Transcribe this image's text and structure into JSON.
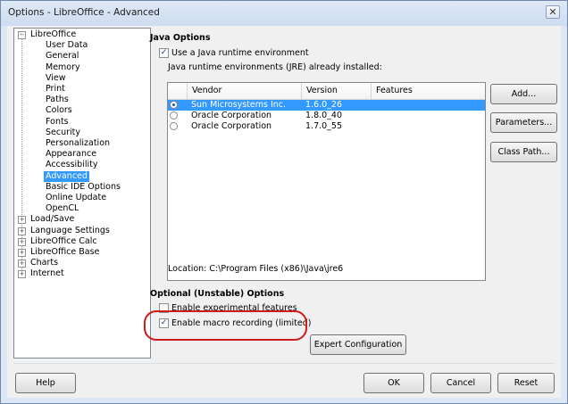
{
  "window": {
    "title": "Options - LibreOffice - Advanced",
    "close_glyph": "✕"
  },
  "tree": {
    "root_label": "LibreOffice",
    "root_children": [
      "User Data",
      "General",
      "Memory",
      "View",
      "Print",
      "Paths",
      "Colors",
      "Fonts",
      "Security",
      "Personalization",
      "Appearance",
      "Accessibility",
      "Advanced",
      "Basic IDE Options",
      "Online Update",
      "OpenCL"
    ],
    "selected": "Advanced",
    "collapsed": [
      "Load/Save",
      "Language Settings",
      "LibreOffice Calc",
      "LibreOffice Base",
      "Charts",
      "Internet"
    ],
    "expanded_glyph": "−",
    "collapsed_glyph": "+"
  },
  "java": {
    "section_title": "Java Options",
    "use_jre_label": "Use a Java runtime environment",
    "use_jre_checked": true,
    "installed_label": "Java runtime environments (JRE) already installed:",
    "columns": {
      "vendor": "Vendor",
      "version": "Version",
      "features": "Features"
    },
    "rows": [
      {
        "vendor": "Sun Microsystems Inc.",
        "version": "1.6.0_26",
        "features": "",
        "selected": true
      },
      {
        "vendor": "Oracle Corporation",
        "version": "1.8.0_40",
        "features": "",
        "selected": false
      },
      {
        "vendor": "Oracle Corporation",
        "version": "1.7.0_55",
        "features": "",
        "selected": false
      }
    ],
    "add_button": "Add...",
    "parameters_button": "Parameters...",
    "class_path_button": "Class Path...",
    "location_text": "Location: C:\\Program Files (x86)\\Java\\jre6"
  },
  "optional": {
    "section_title": "Optional (Unstable) Options",
    "experimental_label": "Enable experimental features",
    "experimental_checked": false,
    "macro_label": "Enable macro recording (limited)",
    "macro_checked": true,
    "expert_button": "Expert Configuration"
  },
  "footer": {
    "help": "Help",
    "ok": "OK",
    "cancel": "Cancel",
    "reset": "Reset"
  },
  "check_glyph": "✓",
  "colors": {
    "selection": "#3399ff",
    "highlight_ring": "#d11a1a"
  }
}
